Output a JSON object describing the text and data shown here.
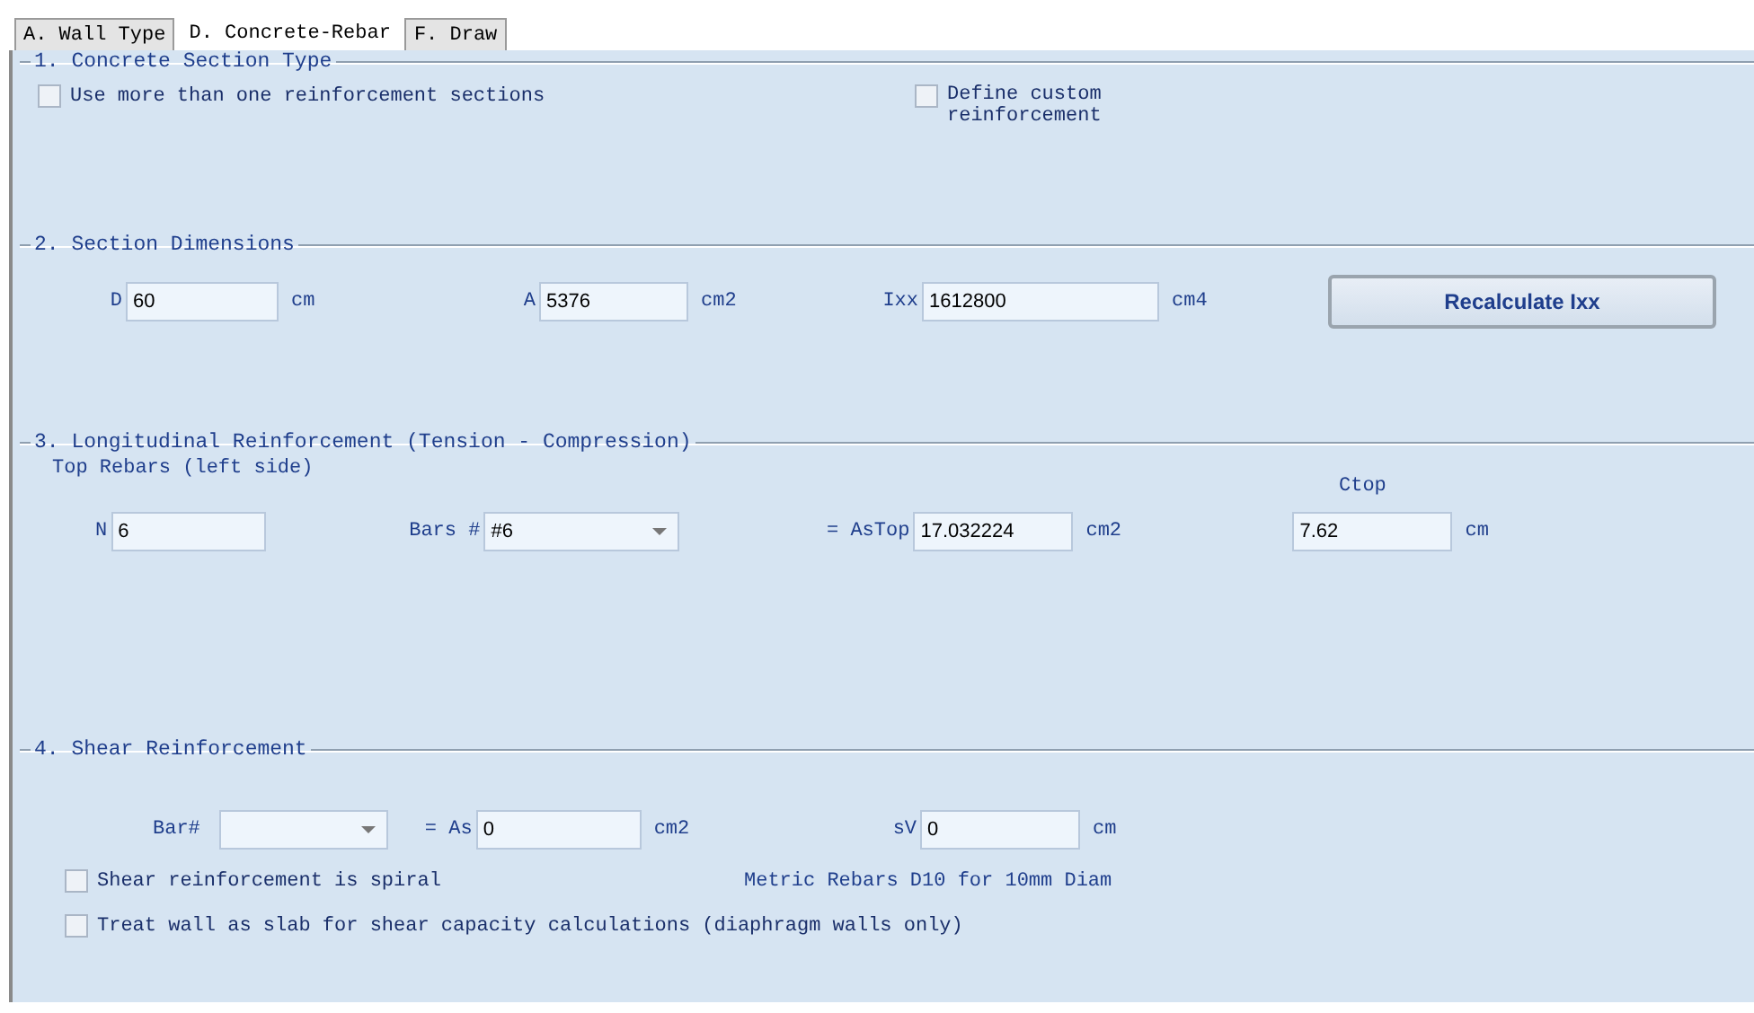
{
  "tabs": [
    {
      "label": "A. Wall Type",
      "selected": false
    },
    {
      "label": "D. Concrete-Rebar",
      "selected": true
    },
    {
      "label": "F. Draw",
      "selected": false
    }
  ],
  "section_1": {
    "title": "1. Concrete Section Type",
    "checkboxes": [
      {
        "label": "Use more than one reinforcement sections",
        "checked": false
      },
      {
        "label": "Define custom reinforcement",
        "checked": false
      }
    ]
  },
  "section_2": {
    "title": "2. Section Dimensions",
    "fields": [
      {
        "label": "D",
        "value": "60",
        "unit": "cm"
      },
      {
        "label": "A",
        "value": "5376",
        "unit": "cm2"
      },
      {
        "label": "Ixx",
        "value": "1612800",
        "unit": "cm4"
      }
    ],
    "button": "Recalculate Ixx"
  },
  "section_3": {
    "title": "3. Longitudinal Reinforcement (Tension - Compression)",
    "subtitle": "Top Rebars (left side)",
    "n": {
      "label": "N",
      "value": "6"
    },
    "bars": {
      "label": "Bars #",
      "value": "#6"
    },
    "as_top": {
      "label": "= AsTop",
      "value": "17.032224",
      "unit": "cm2"
    },
    "ctop": {
      "label": "Ctop",
      "value": "7.62",
      "unit": "cm"
    }
  },
  "section_4": {
    "title": "4. Shear Reinforcement",
    "bar": {
      "label": "Bar#"
    },
    "as": {
      "label": "= As",
      "value": "0",
      "unit": "cm2"
    },
    "sv": {
      "label": "sV",
      "value": "0",
      "unit": "cm"
    },
    "checkboxes": [
      {
        "label": "Shear reinforcement is spiral",
        "checked": false
      },
      {
        "label": "Treat wall as slab for shear capacity calculations (diaphragm walls only)",
        "checked": false
      }
    ],
    "note": "Metric Rebars D10 for 10mm Diam"
  }
}
